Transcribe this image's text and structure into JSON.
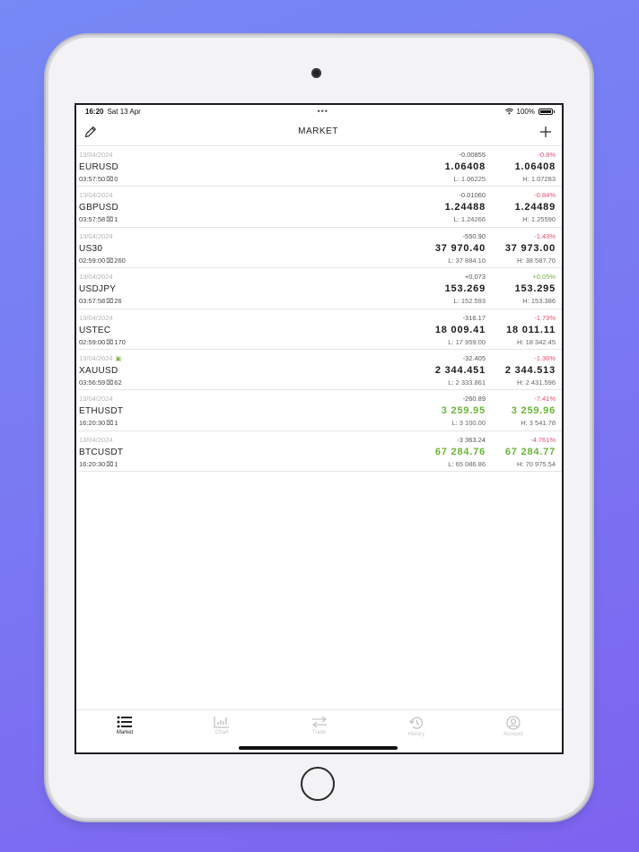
{
  "status_bar": {
    "time": "16:20",
    "date": "Sat 13 Apr",
    "battery": "100%"
  },
  "nav": {
    "title": "MARKET"
  },
  "icons": {
    "edit": "pencil-icon",
    "add": "plus-icon"
  },
  "quotes": [
    {
      "date": "13/04/2024",
      "symbol": "EURUSD",
      "time": "03:57:50",
      "spread": "0",
      "change": "-0.00855",
      "pct": "-0.8%",
      "pct_dir": "neg",
      "bid": "1.06408",
      "ask": "1.06408",
      "low": "L: 1.06225",
      "high": "H: 1.07283",
      "green": false,
      "flag": false
    },
    {
      "date": "13/04/2024",
      "symbol": "GBPUSD",
      "time": "03:57:58",
      "spread": "1",
      "change": "-0.01060",
      "pct": "-0.84%",
      "pct_dir": "neg",
      "bid": "1.24488",
      "ask": "1.24489",
      "low": "L: 1.24266",
      "high": "H: 1.25590",
      "green": false,
      "flag": false
    },
    {
      "date": "13/04/2024",
      "symbol": "US30",
      "time": "02:59:00",
      "spread": "260",
      "change": "-550.90",
      "pct": "-1.43%",
      "pct_dir": "neg",
      "bid": "37 970.40",
      "ask": "37 973.00",
      "low": "L: 37 884.10",
      "high": "H: 38 587.70",
      "green": false,
      "flag": false
    },
    {
      "date": "13/04/2024",
      "symbol": "USDJPY",
      "time": "03:57:58",
      "spread": "26",
      "change": "+0.073",
      "pct": "+0.05%",
      "pct_dir": "pos",
      "bid": "153.269",
      "ask": "153.295",
      "low": "L: 152.593",
      "high": "H: 153.386",
      "green": false,
      "flag": false
    },
    {
      "date": "13/04/2024",
      "symbol": "USTEC",
      "time": "02:59:00",
      "spread": "170",
      "change": "-316.17",
      "pct": "-1.73%",
      "pct_dir": "neg",
      "bid": "18 009.41",
      "ask": "18 011.11",
      "low": "L: 17 959.00",
      "high": "H: 18 342.45",
      "green": false,
      "flag": false
    },
    {
      "date": "13/04/2024",
      "symbol": "XAUUSD",
      "time": "03:56:59",
      "spread": "62",
      "change": "-32.405",
      "pct": "-1.36%",
      "pct_dir": "neg",
      "bid": "2 344.451",
      "ask": "2 344.513",
      "low": "L: 2 333.861",
      "high": "H: 2 431.596",
      "green": false,
      "flag": true
    },
    {
      "date": "13/04/2024",
      "symbol": "ETHUSDT",
      "time": "16:20:30",
      "spread": "1",
      "change": "-260.89",
      "pct": "-7.41%",
      "pct_dir": "neg",
      "bid": "3 259.95",
      "ask": "3 259.96",
      "low": "L: 3 100.00",
      "high": "H: 3 541.78",
      "green": true,
      "flag": false
    },
    {
      "date": "13/04/2024",
      "symbol": "BTCUSDT",
      "time": "16:20:30",
      "spread": "1",
      "change": "-3 363.24",
      "pct": "-4.761%",
      "pct_dir": "neg",
      "bid": "67 284.76",
      "ask": "67 284.77",
      "low": "L: 65 086.86",
      "high": "H: 70 975.54",
      "green": true,
      "flag": false
    }
  ],
  "tabs": [
    {
      "label": "Market",
      "icon": "list-icon",
      "active": true
    },
    {
      "label": "Chart",
      "icon": "chart-icon",
      "active": false
    },
    {
      "label": "Trade",
      "icon": "arrows-icon",
      "active": false
    },
    {
      "label": "History",
      "icon": "history-icon",
      "active": false
    },
    {
      "label": "Account",
      "icon": "account-icon",
      "active": false
    }
  ],
  "colors": {
    "negative": "#ec4d6e",
    "positive": "#7cb342",
    "background": "#7a78f2"
  }
}
